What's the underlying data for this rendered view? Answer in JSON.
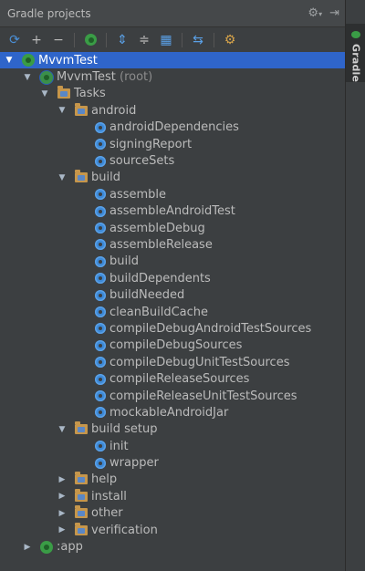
{
  "panel": {
    "title": "Gradle projects",
    "settings_icon": "gear-icon",
    "hide_icon": "hide-panel-icon"
  },
  "side_tab": {
    "label": "Gradle"
  },
  "toolbar": {
    "buttons": [
      "refresh-icon",
      "add-icon",
      "remove-icon",
      "execute-task-icon",
      "expand-all-icon",
      "collapse-all-icon",
      "group-tasks-icon",
      "offline-mode-icon",
      "settings-icon"
    ]
  },
  "tree": {
    "project": "MvvmTest",
    "root_module": "MvvmTest",
    "root_suffix": "(root)",
    "tasks": "Tasks",
    "groups": {
      "android": {
        "label": "android",
        "tasks": [
          "androidDependencies",
          "signingReport",
          "sourceSets"
        ]
      },
      "build": {
        "label": "build",
        "tasks": [
          "assemble",
          "assembleAndroidTest",
          "assembleDebug",
          "assembleRelease",
          "build",
          "buildDependents",
          "buildNeeded",
          "cleanBuildCache",
          "compileDebugAndroidTestSources",
          "compileDebugSources",
          "compileDebugUnitTestSources",
          "compileReleaseSources",
          "compileReleaseUnitTestSources",
          "mockableAndroidJar"
        ]
      },
      "build_setup": {
        "label": "build setup",
        "tasks": [
          "init",
          "wrapper"
        ]
      },
      "help": {
        "label": "help"
      },
      "install": {
        "label": "install"
      },
      "other": {
        "label": "other"
      },
      "verification": {
        "label": "verification"
      }
    },
    "app_module": ":app"
  },
  "colors": {
    "background": "#3c3f41",
    "selection": "#2f65ca",
    "text": "#bbbbbb",
    "folder": "#c6964b",
    "task_gear": "#3d8ad8",
    "gradle_green": "#3a9c46"
  }
}
